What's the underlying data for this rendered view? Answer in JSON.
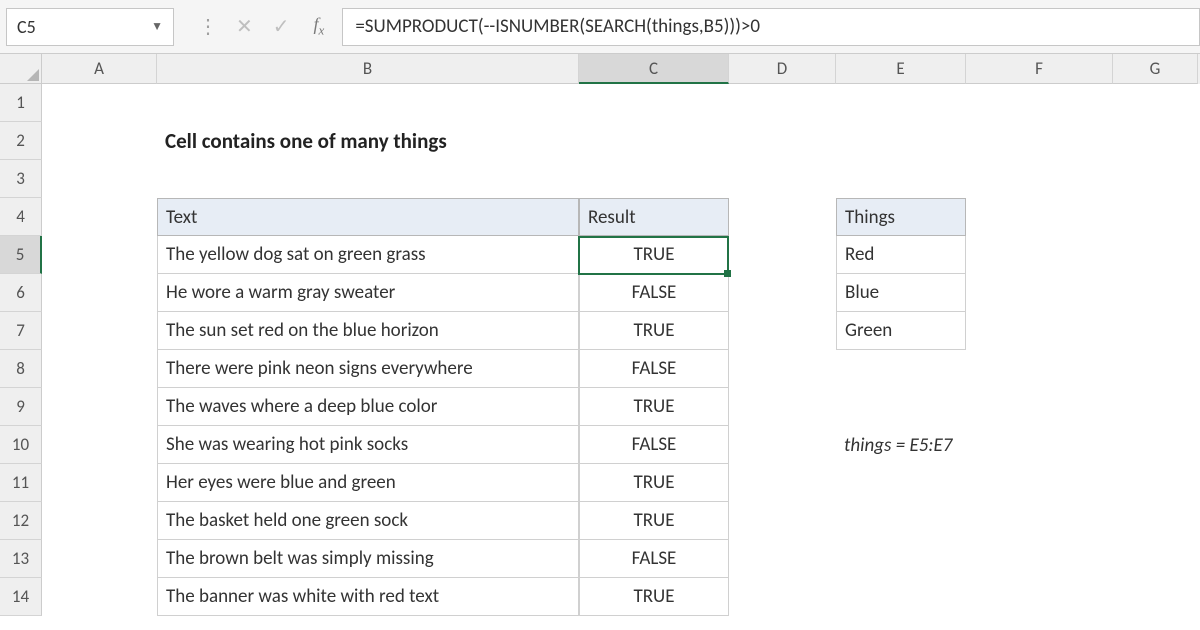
{
  "formula_bar": {
    "active_cell_ref": "C5",
    "formula": "=SUMPRODUCT(--ISNUMBER(SEARCH(things,B5)))>0"
  },
  "columns": [
    "A",
    "B",
    "C",
    "D",
    "E",
    "F",
    "G"
  ],
  "row_numbers": [
    "1",
    "2",
    "3",
    "4",
    "5",
    "6",
    "7",
    "8",
    "9",
    "10",
    "11",
    "12",
    "13",
    "14"
  ],
  "title": "Cell contains one of many things",
  "table_main": {
    "header_text": "Text",
    "header_result": "Result",
    "rows": [
      {
        "text": "The yellow dog sat on green grass",
        "result": "TRUE"
      },
      {
        "text": "He wore a warm gray sweater",
        "result": "FALSE"
      },
      {
        "text": "The sun set red on the blue horizon",
        "result": "TRUE"
      },
      {
        "text": "There were pink neon signs everywhere",
        "result": "FALSE"
      },
      {
        "text": "The waves where a deep blue color",
        "result": "TRUE"
      },
      {
        "text": "She was wearing hot pink socks",
        "result": "FALSE"
      },
      {
        "text": "Her eyes were blue and green",
        "result": "TRUE"
      },
      {
        "text": "The basket held one green sock",
        "result": "TRUE"
      },
      {
        "text": "The brown belt was simply missing",
        "result": "FALSE"
      },
      {
        "text": "The banner was white with red text",
        "result": "TRUE"
      }
    ]
  },
  "things_table": {
    "header": "Things",
    "items": [
      "Red",
      "Blue",
      "Green"
    ]
  },
  "note": "things = E5:E7",
  "selected": {
    "col": "C",
    "row": "5"
  }
}
